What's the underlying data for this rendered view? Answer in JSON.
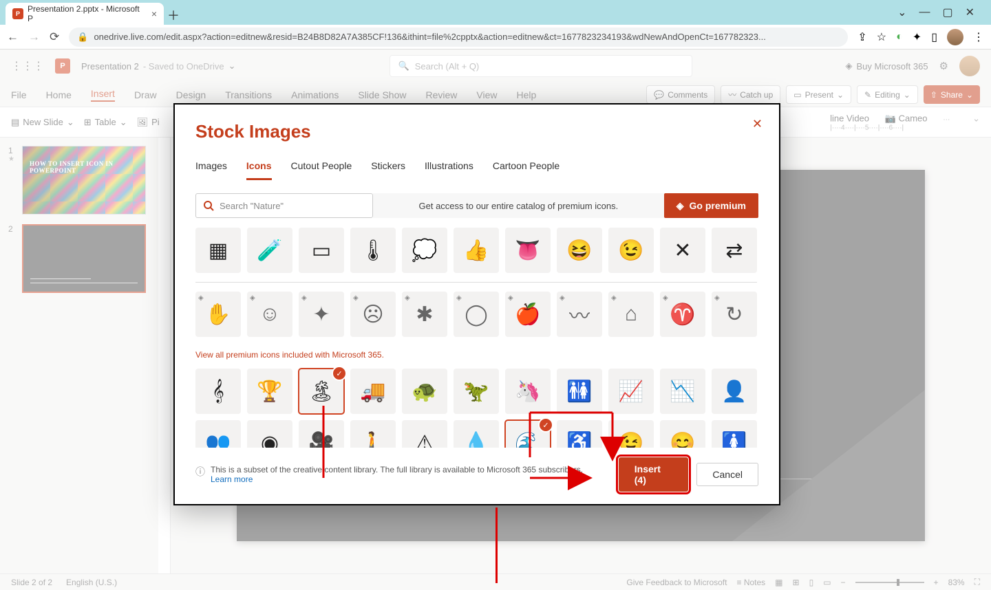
{
  "browser": {
    "tab_title": "Presentation 2.pptx - Microsoft P",
    "url": "onedrive.live.com/edit.aspx?action=editnew&resid=B24B8D82A7A385CF!136&ithint=file%2cpptx&action=editnew&ct=1677823234193&wdNewAndOpenCt=167782323..."
  },
  "app": {
    "title_a": "Presentation 2",
    "title_b": "- Saved to OneDrive",
    "search_placeholder": "Search (Alt + Q)",
    "buy": "Buy Microsoft 365"
  },
  "ribbon_tabs": [
    "File",
    "Home",
    "Insert",
    "Draw",
    "Design",
    "Transitions",
    "Animations",
    "Slide Show",
    "Review",
    "View",
    "Help"
  ],
  "ribbon_active": "Insert",
  "ribbon_right": {
    "comments": "Comments",
    "catchup": "Catch up",
    "present": "Present",
    "editing": "Editing",
    "share": "Share"
  },
  "toolbar": {
    "new_slide": "New Slide",
    "table": "Table",
    "pictures": "Pi",
    "video": "line Video",
    "cameo": "Cameo"
  },
  "ruler_marks": "|····4····|····5····|····6····|",
  "thumbnails": [
    {
      "num": "1",
      "title": "HOW TO INSERT ICON IN POWERPOINT"
    },
    {
      "num": "2"
    }
  ],
  "status": {
    "slide": "Slide 2 of 2",
    "lang": "English (U.S.)",
    "feedback": "Give Feedback to Microsoft",
    "notes": "Notes",
    "zoom": "83%"
  },
  "modal": {
    "title": "Stock Images",
    "tabs": [
      "Images",
      "Icons",
      "Cutout People",
      "Stickers",
      "Illustrations",
      "Cartoon People"
    ],
    "active_tab": "Icons",
    "search_placeholder": "Search \"Nature\"",
    "premium_text": "Get access to our entire catalog of premium icons.",
    "go_premium": "Go premium",
    "premium_link": "View all premium icons included with Microsoft 365.",
    "footer_text_a": "This is a subset of the creative content library. The full library is available to Microsoft 365 subscribers.",
    "footer_learn": "Learn more",
    "insert_label": "Insert (4)",
    "cancel_label": "Cancel",
    "icons_row1": [
      "presentation",
      "test-tubes",
      "theater",
      "thermometer",
      "thought",
      "thumbs-up",
      "tongue",
      "laugh-squint",
      "laugh-wink",
      "tools",
      "transfer"
    ],
    "icons_premium": [
      "fish-hand",
      "angel-smile",
      "compress",
      "angry-face",
      "mosquito",
      "aperture",
      "apple",
      "wave-chart",
      "house-analytics",
      "aries",
      "cycle"
    ],
    "icons_row3": [
      "treble-clef",
      "trophy",
      "tropical",
      "truck",
      "turtle",
      "trex",
      "unicorn",
      "restroom",
      "line-chart",
      "chart-down",
      "user"
    ],
    "icons_row4": [
      "users",
      "venn",
      "video-camera",
      "walking",
      "warning",
      "water-drop",
      "wave",
      "wheelchair",
      "wink",
      "wink-face",
      "woman"
    ],
    "selected": [
      "tropical",
      "wave"
    ],
    "glyphs": {
      "presentation": "▦",
      "test-tubes": "🧪",
      "theater": "▭",
      "thermometer": "🌡",
      "thought": "💭",
      "thumbs-up": "👍",
      "tongue": "👅",
      "laugh-squint": "😆",
      "laugh-wink": "😉",
      "tools": "✕",
      "transfer": "⇄",
      "fish-hand": "✋",
      "angel-smile": "☺",
      "compress": "✦",
      "angry-face": "☹",
      "mosquito": "✱",
      "aperture": "◯",
      "apple": "🍎",
      "wave-chart": "〰",
      "house-analytics": "⌂",
      "aries": "♈",
      "cycle": "↻",
      "treble-clef": "𝄞",
      "trophy": "🏆",
      "tropical": "🏝",
      "truck": "🚚",
      "turtle": "🐢",
      "trex": "🦖",
      "unicorn": "🦄",
      "restroom": "🚻",
      "line-chart": "📈",
      "chart-down": "📉",
      "user": "👤",
      "users": "👥",
      "venn": "◉",
      "video-camera": "🎥",
      "walking": "🚶",
      "warning": "⚠",
      "water-drop": "💧",
      "wave": "🌊",
      "wheelchair": "♿",
      "wink": "😉",
      "wink-face": "😊",
      "woman": "🚺"
    }
  }
}
